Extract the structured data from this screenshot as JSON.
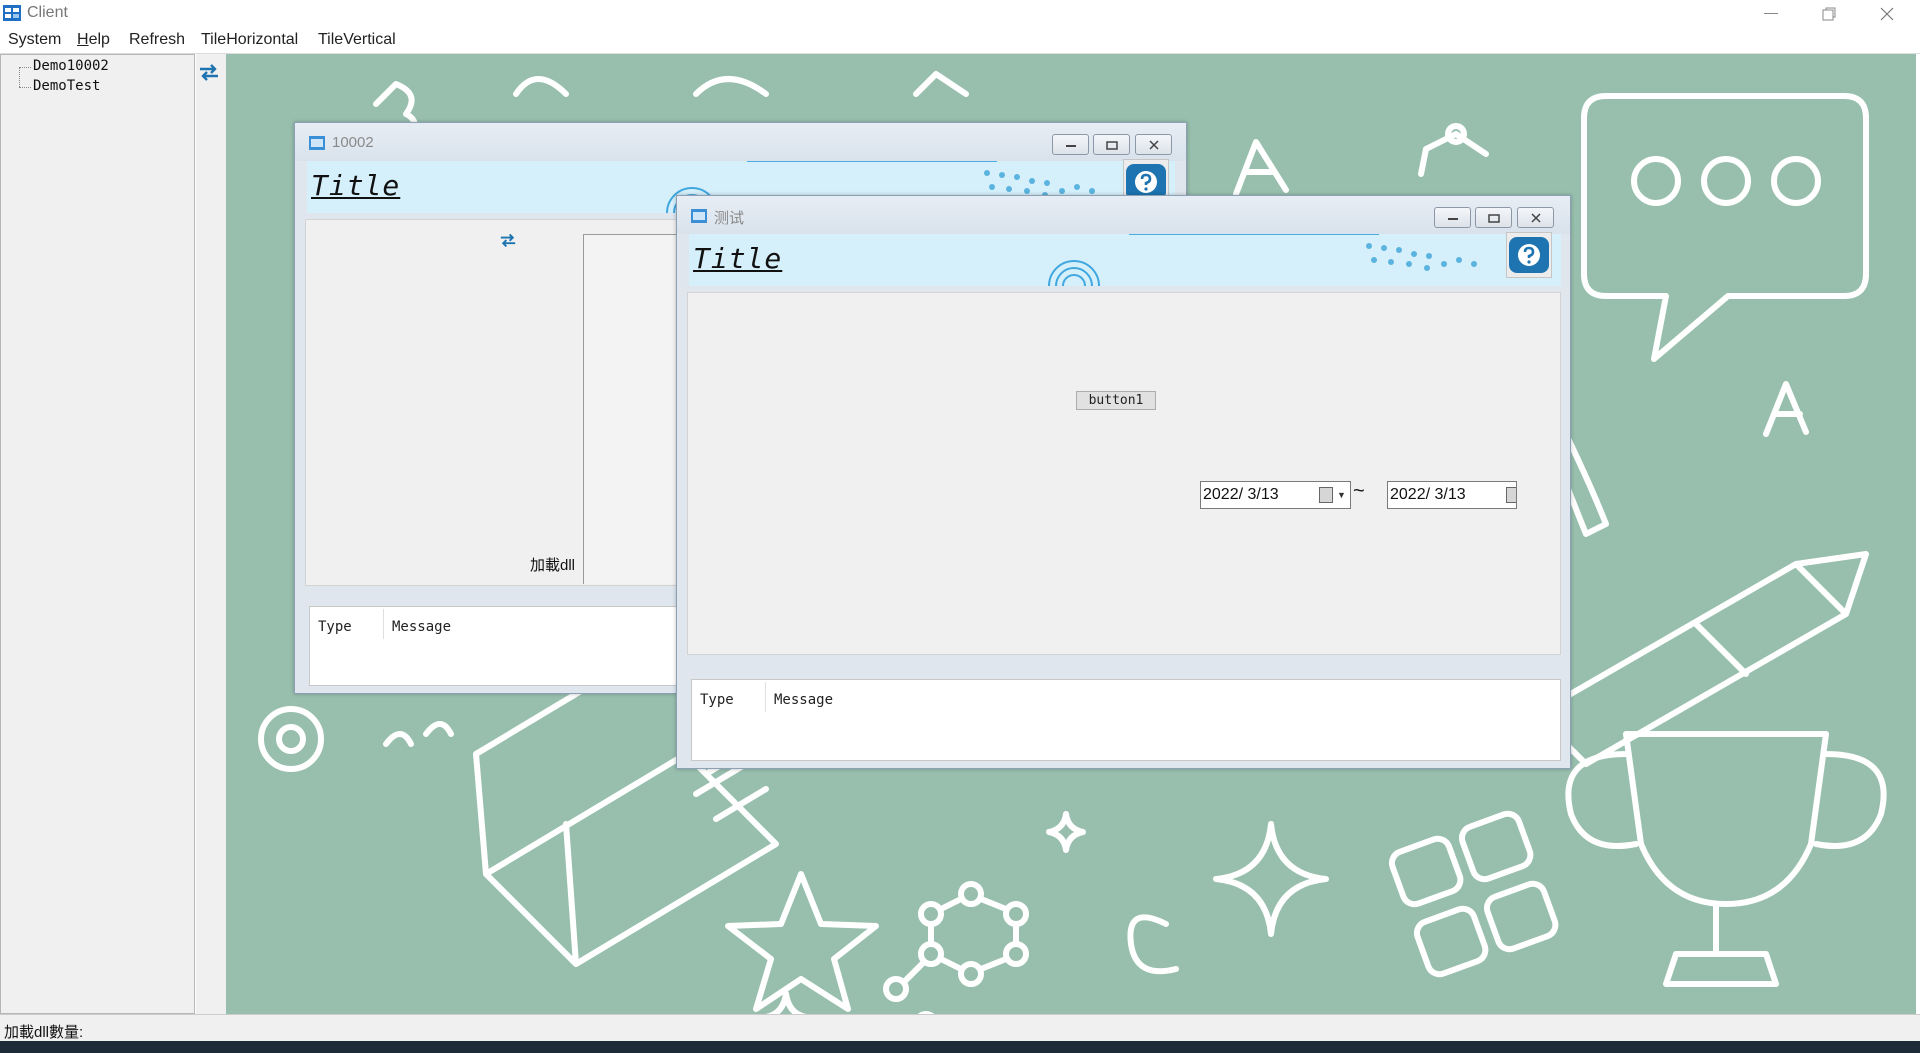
{
  "window": {
    "title": "Client",
    "minimize": "—",
    "restore": "❐",
    "close": "✕"
  },
  "menu": [
    {
      "label": "System"
    },
    {
      "label": "Help"
    },
    {
      "label": "Refresh"
    },
    {
      "label": "TileHorizontal"
    },
    {
      "label": "TileVertical"
    }
  ],
  "tree": {
    "items": [
      {
        "label": "Demo10002"
      },
      {
        "label": "DemoTest"
      }
    ]
  },
  "status": {
    "label": "加載dll數量:"
  },
  "child1": {
    "title": "10002",
    "banner_title": "Title",
    "load_label": "加載dll",
    "grid": {
      "type_col": "Type",
      "message_col": "Message"
    }
  },
  "child2": {
    "title": "测试",
    "banner_title": "Title",
    "button1": "button1",
    "date_from": "2022/  3/13",
    "date_to": "2022/  3/13",
    "tilde": "~",
    "grid": {
      "type_col": "Type",
      "message_col": "Message"
    }
  },
  "colors": {
    "accent": "#1d74b0",
    "mdi_background": "#98bfae",
    "banner": "#d5f0fb"
  },
  "icons": [
    "app-icon",
    "swap-icon",
    "minimize-icon",
    "restore-icon",
    "close-icon",
    "help-icon",
    "calendar-icon"
  ]
}
